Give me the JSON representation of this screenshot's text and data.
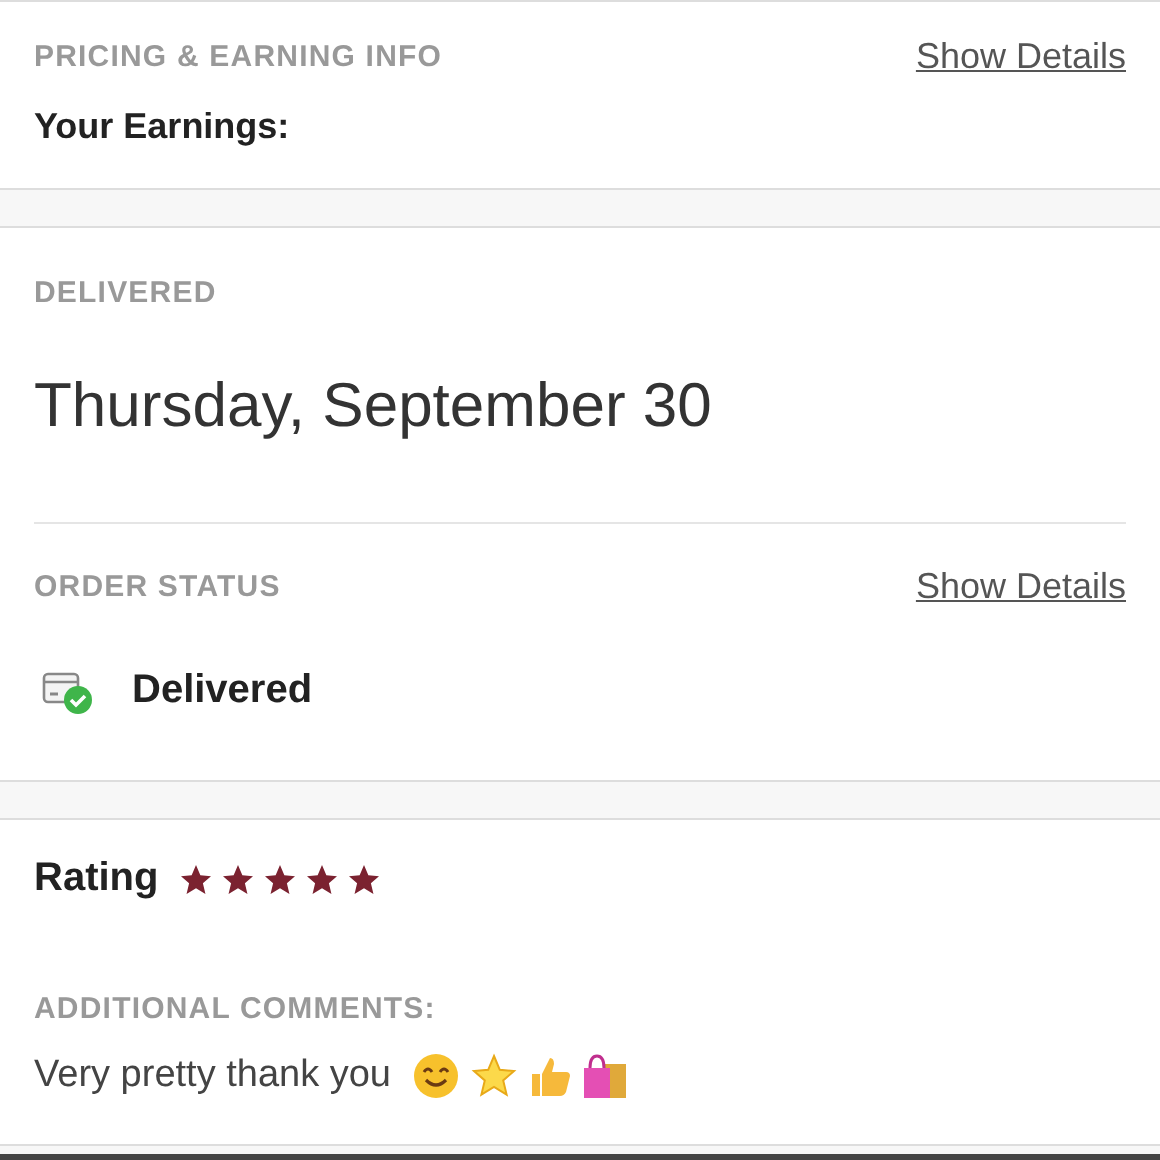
{
  "pricing": {
    "heading": "PRICING & EARNING INFO",
    "link": "Show Details",
    "earnings_label": "Your Earnings:"
  },
  "delivered": {
    "heading": "DELIVERED",
    "date": "Thursday, September 30"
  },
  "order_status": {
    "heading": "ORDER STATUS",
    "link": "Show Details",
    "status": "Delivered"
  },
  "rating": {
    "label": "Rating",
    "stars": 5
  },
  "comments": {
    "heading": "ADDITIONAL COMMENTS:",
    "text": "Very pretty thank you"
  }
}
